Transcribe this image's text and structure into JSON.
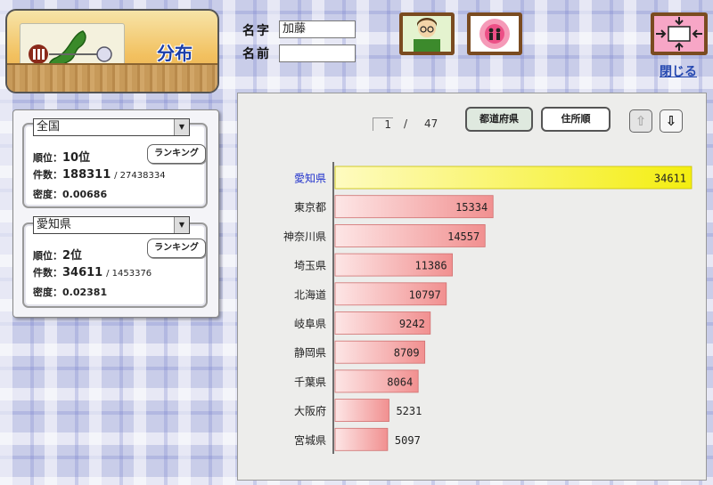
{
  "header": {
    "title": "分布",
    "surname_label": "名字",
    "surname_value": "加藤",
    "given_label": "名前",
    "given_value": "",
    "close_label": "閉じる"
  },
  "national": {
    "selected": "全国",
    "rank_label": "順位：",
    "rank_value": "10位",
    "count_label": "件数：",
    "count_value": "188311",
    "total_value": "/ 27438334",
    "density_label": "密度：",
    "density_value": "0.00686",
    "ranking_button": "ランキング"
  },
  "prefecture": {
    "selected": "愛知県",
    "rank_label": "順位：",
    "rank_value": "2位",
    "count_label": "件数：",
    "count_value": "34611",
    "total_value": "/ 1453376",
    "density_label": "密度：",
    "density_value": "0.02381",
    "ranking_button": "ランキング"
  },
  "toolbar": {
    "page_current": "1",
    "page_sep": "/",
    "page_total": "47",
    "sort_prefecture": "都道府県",
    "sort_address": "住所順"
  },
  "colors": {
    "highlight_bar": "#f5ef1c",
    "normal_bar": "#f39a9a",
    "highlight_label": "#2233cc"
  },
  "chart_data": {
    "type": "bar",
    "orientation": "horizontal",
    "categories": [
      "愛知県",
      "東京都",
      "神奈川県",
      "埼玉県",
      "北海道",
      "岐阜県",
      "静岡県",
      "千葉県",
      "大阪府",
      "宮城県"
    ],
    "values": [
      34611,
      15334,
      14557,
      11386,
      10797,
      9242,
      8709,
      8064,
      5231,
      5097
    ],
    "highlighted": "愛知県",
    "xlim": [
      0,
      34611
    ]
  }
}
